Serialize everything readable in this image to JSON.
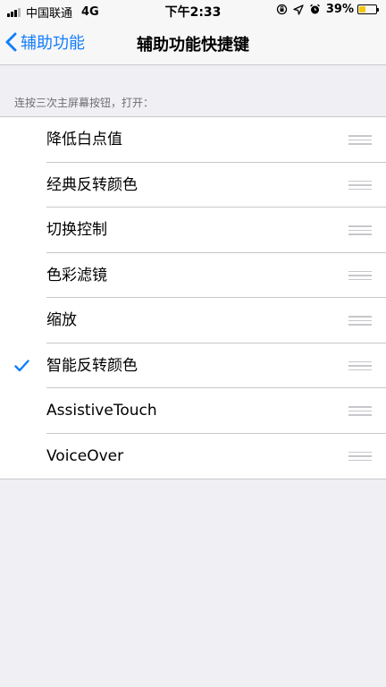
{
  "status_bar": {
    "carrier": "中国联通",
    "network": "4G",
    "time": "下午2:33",
    "battery_percent": "39%",
    "battery_level": 0.39,
    "icons": [
      "signal-icon",
      "orientation-lock-icon",
      "location-icon",
      "alarm-icon",
      "battery-icon"
    ]
  },
  "nav": {
    "back_label": "辅助功能",
    "title": "辅助功能快捷键"
  },
  "section_header": "连按三次主屏幕按钮，打开：",
  "items": [
    {
      "label": "降低白点值",
      "checked": false
    },
    {
      "label": "经典反转颜色",
      "checked": false
    },
    {
      "label": "切换控制",
      "checked": false
    },
    {
      "label": "色彩滤镜",
      "checked": false
    },
    {
      "label": "缩放",
      "checked": false
    },
    {
      "label": "智能反转颜色",
      "checked": true
    },
    {
      "label": "AssistiveTouch",
      "checked": false
    },
    {
      "label": "VoiceOver",
      "checked": false
    }
  ],
  "colors": {
    "accent": "#147efb",
    "background": "#efeff4",
    "separator": "#c8c7cc",
    "battery": "#f7c600"
  }
}
